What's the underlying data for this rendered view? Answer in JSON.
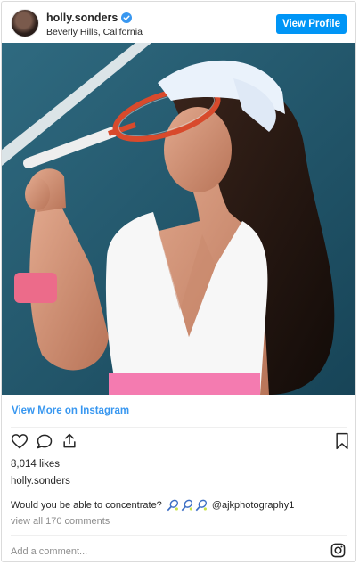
{
  "header": {
    "username": "holly.sonders",
    "location": "Beverly Hills, California",
    "view_profile_label": "View Profile"
  },
  "post": {
    "view_more_label": "View More on Instagram",
    "likes": "8,014 likes",
    "caption_user": "holly.sonders",
    "caption_text": "Would you be able to concentrate?",
    "caption_emoji": "tennis-racket-emoji",
    "caption_mention": "@ajkphotography1",
    "comments_link": "view all 170 comments",
    "add_comment_placeholder": "Add a comment..."
  },
  "icons": [
    "verified-badge-icon",
    "heart-icon",
    "comment-icon",
    "share-icon",
    "bookmark-icon",
    "instagram-icon"
  ],
  "colors": {
    "accent": "#0095f6",
    "link": "#3897f0",
    "muted": "#8e8e8e",
    "text": "#262626",
    "border": "#dbdbdb"
  }
}
